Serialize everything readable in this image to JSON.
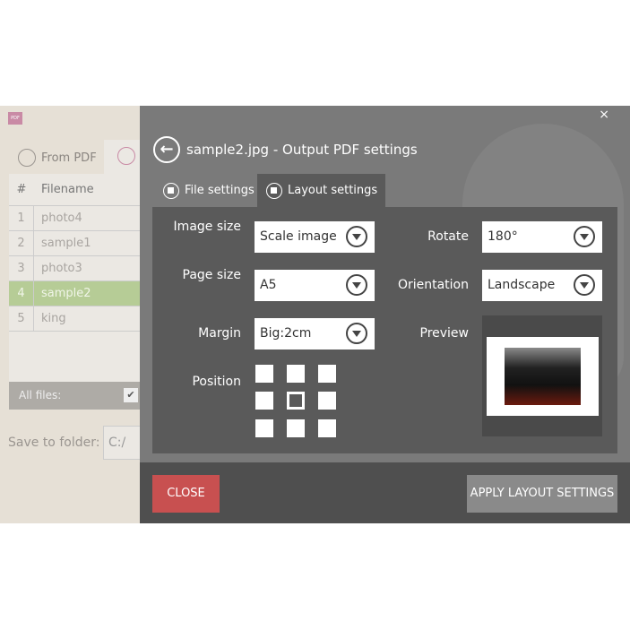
{
  "app": {
    "logo_text": "PDF",
    "tabs": [
      {
        "label": "From PDF"
      }
    ],
    "table": {
      "headers": [
        "#",
        "Filename"
      ],
      "rows": [
        [
          "1",
          "photo4"
        ],
        [
          "2",
          "sample1"
        ],
        [
          "3",
          "photo3"
        ],
        [
          "4",
          "sample2"
        ],
        [
          "5",
          "king"
        ]
      ],
      "selected_row": 4
    },
    "all_files_label": "All files:",
    "all_files_checked": true,
    "check_glyph": "✔",
    "save_label": "Save to folder:",
    "save_value": "C:/"
  },
  "dialog": {
    "close_glyph": "×",
    "back_glyph": "←",
    "title": "sample2.jpg - Output PDF settings",
    "tabs": [
      {
        "label": "File settings"
      },
      {
        "label": "Layout settings",
        "active": true
      }
    ],
    "fields": {
      "image_size": {
        "label": "Image size",
        "value": "Scale image"
      },
      "page_size": {
        "label": "Page size",
        "value": "A5"
      },
      "margin": {
        "label": "Margin",
        "value": "Big:2cm"
      },
      "rotate": {
        "label": "Rotate",
        "value": "180°"
      },
      "orientation": {
        "label": "Orientation",
        "value": "Landscape"
      },
      "position": {
        "label": "Position",
        "selected": "center"
      },
      "preview": {
        "label": "Preview"
      }
    },
    "buttons": {
      "close": "CLOSE",
      "apply": "APPLY LAYOUT SETTINGS"
    },
    "colors": {
      "close": "#c85050",
      "selected_row": "#b6cc96"
    }
  }
}
